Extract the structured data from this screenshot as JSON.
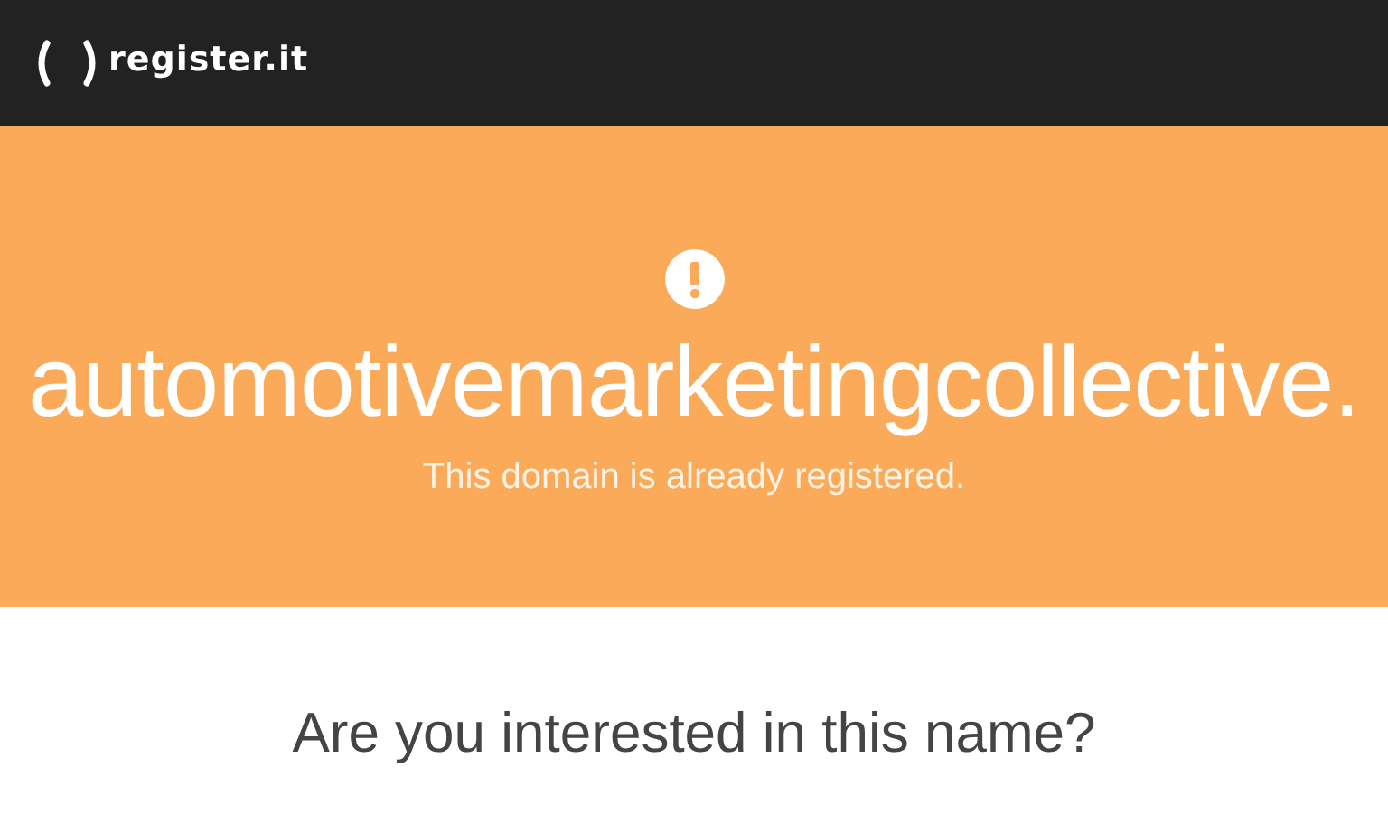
{
  "header": {
    "logo_text": "register.it"
  },
  "banner": {
    "domain": "automotivemarketingcollective.",
    "message": "This domain is already registered."
  },
  "question": "Are you interested in this name?"
}
